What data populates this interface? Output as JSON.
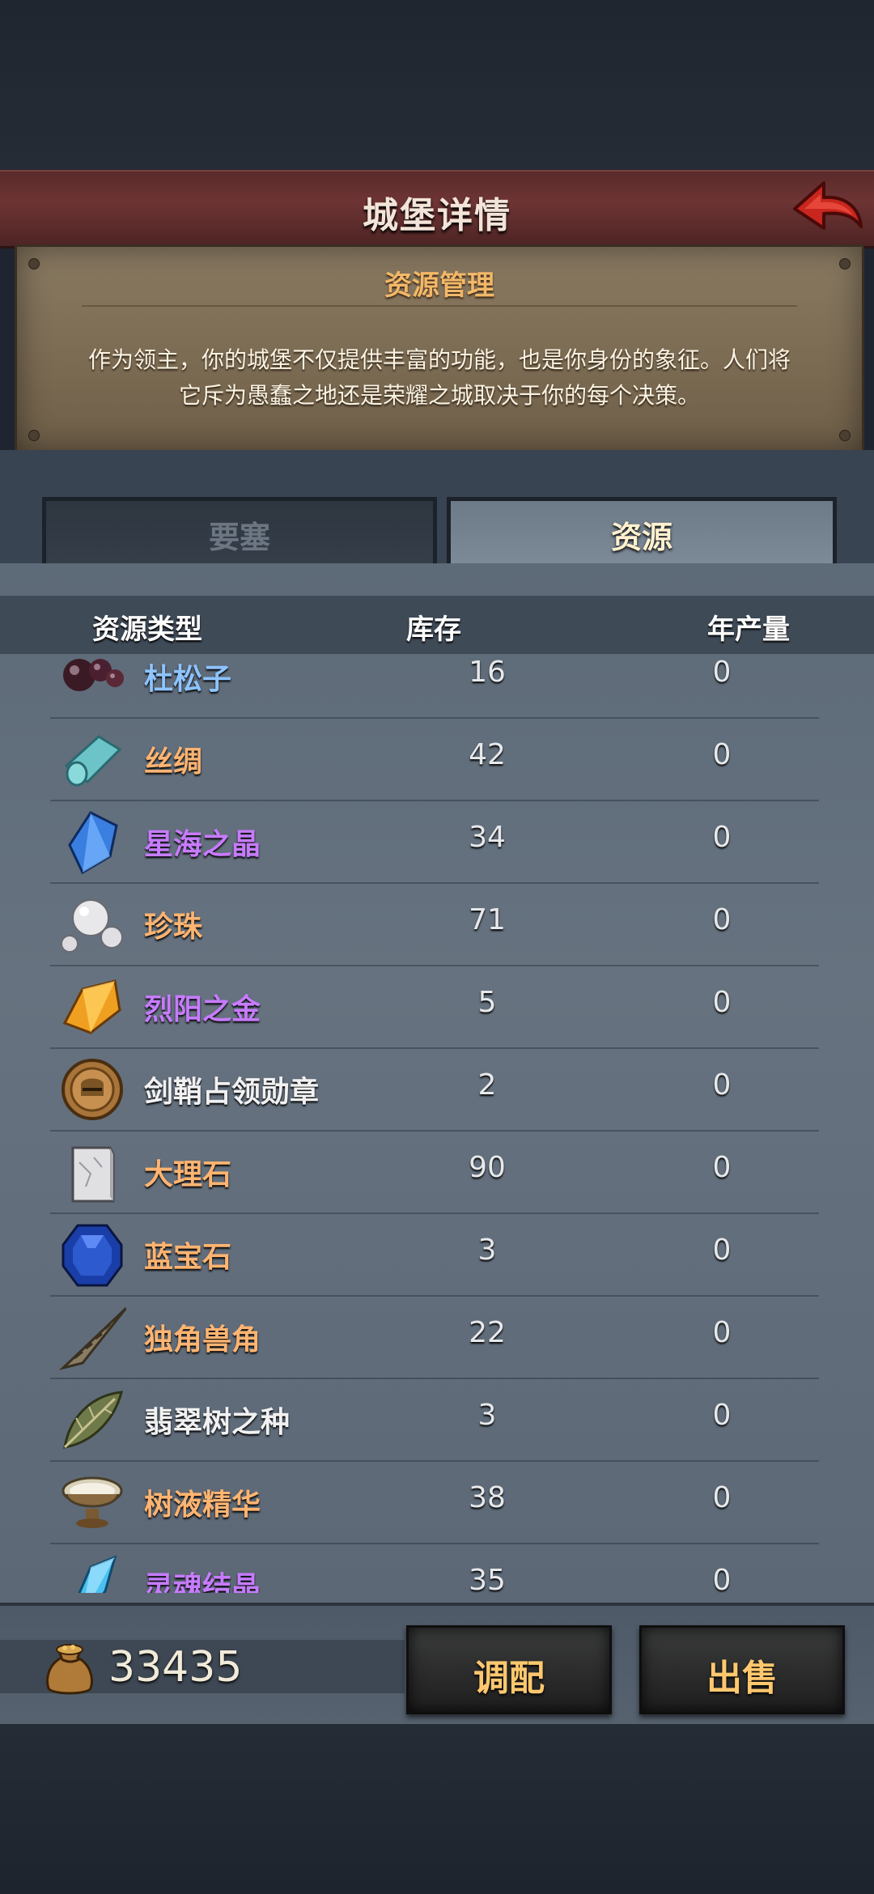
{
  "header": {
    "title": "城堡详情",
    "back_icon": "back-arrow-icon",
    "accent": "#c8261e"
  },
  "info_box": {
    "heading": "资源管理",
    "lines": [
      "作为领主，你的城堡不仅提供丰富的功能，也是你身份的象征。人们将",
      "它斥为愚蠢之地还是荣耀之城取决于你的每个决策。"
    ]
  },
  "tabs": [
    {
      "label": "要塞",
      "active": false
    },
    {
      "label": "资源",
      "active": true
    }
  ],
  "columns": {
    "type": "资源类型",
    "stock": "库存",
    "annual": "年产量"
  },
  "resources": [
    {
      "name": "杜松子",
      "stock": "16",
      "annual": "0",
      "icon": "juniper-berries-icon",
      "color": "#8ec4ff"
    },
    {
      "name": "丝绸",
      "stock": "42",
      "annual": "0",
      "icon": "silk-roll-icon",
      "color": "#ffb471"
    },
    {
      "name": "星海之晶",
      "stock": "34",
      "annual": "0",
      "icon": "blue-crystal-icon",
      "color": "#c77bff"
    },
    {
      "name": "珍珠",
      "stock": "71",
      "annual": "0",
      "icon": "pearls-icon",
      "color": "#ffb471"
    },
    {
      "name": "烈阳之金",
      "stock": "5",
      "annual": "0",
      "icon": "gold-crystal-icon",
      "color": "#c77bff"
    },
    {
      "name": "剑鞘占领勋章",
      "stock": "2",
      "annual": "0",
      "icon": "medal-helmet-icon",
      "color": "#f1f1f1"
    },
    {
      "name": "大理石",
      "stock": "90",
      "annual": "0",
      "icon": "marble-block-icon",
      "color": "#ffb471"
    },
    {
      "name": "蓝宝石",
      "stock": "3",
      "annual": "0",
      "icon": "sapphire-icon",
      "color": "#ffb471"
    },
    {
      "name": "独角兽角",
      "stock": "22",
      "annual": "0",
      "icon": "unicorn-horn-icon",
      "color": "#ffb471"
    },
    {
      "name": "翡翠树之种",
      "stock": "3",
      "annual": "0",
      "icon": "emerald-seed-icon",
      "color": "#f1f1f1"
    },
    {
      "name": "树液精华",
      "stock": "38",
      "annual": "0",
      "icon": "sap-bowl-icon",
      "color": "#ffb471"
    },
    {
      "name": "灵魂结晶",
      "stock": "35",
      "annual": "0",
      "icon": "soul-crystal-icon",
      "color": "#c77bff"
    }
  ],
  "footer": {
    "gold_icon": "gold-sack-icon",
    "gold_amount": "33435",
    "allocate_label": "调配",
    "sell_label": "出售"
  }
}
